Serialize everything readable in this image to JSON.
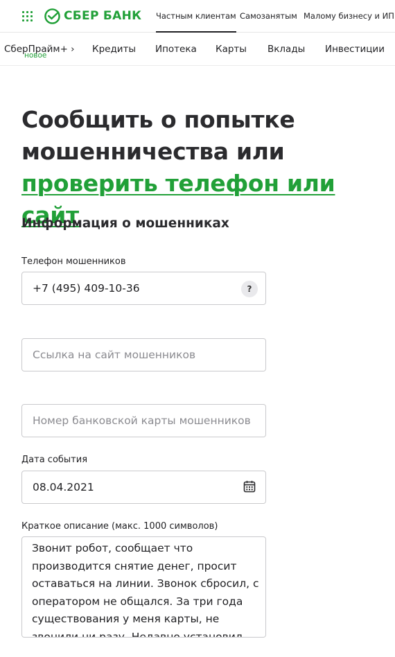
{
  "header": {
    "logo_text": "СБЕР БАНК",
    "nav": [
      {
        "label": "Частным клиентам",
        "active": true
      },
      {
        "label": "Самозанятым",
        "active": false
      },
      {
        "label": "Малому бизнесу и ИП",
        "active": false
      }
    ]
  },
  "subnav": {
    "prime_label": "СберПрайм+ ›",
    "prime_badge": "новое",
    "items": [
      "Кредиты",
      "Ипотека",
      "Карты",
      "Вклады",
      "Инвестиции"
    ]
  },
  "page": {
    "title_part1": "Сообщить о попытке мошенничества или ",
    "title_link": "проверить телефон или сайт",
    "section_title": "Информация о мошенниках"
  },
  "form": {
    "phone_label": "Телефон мошенников",
    "phone_value": "+7 (495) 409-10-36",
    "phone_help": "?",
    "site_placeholder": "Ссылка на сайт мошенников",
    "card_placeholder": "Номер банковской карты мошенников",
    "date_label": "Дата события",
    "date_value": "08.04.2021",
    "description_label": "Краткое описание (макс. 1000 символов)",
    "description_value": "Звонит робот, сообщает что производится снятие денег, просит оставаться на линии. Звонок сбросил, с оператором не общался. За три года существования у меня карты, не звонили ни разу. Недавно установил приложение"
  },
  "colors": {
    "brand_green": "#21a038",
    "text": "#1f1f22",
    "border": "#c9c9cc"
  },
  "icons": {
    "menu": "grid-dots-icon",
    "logo": "sber-logo-icon",
    "help": "question-icon",
    "calendar": "calendar-icon"
  }
}
